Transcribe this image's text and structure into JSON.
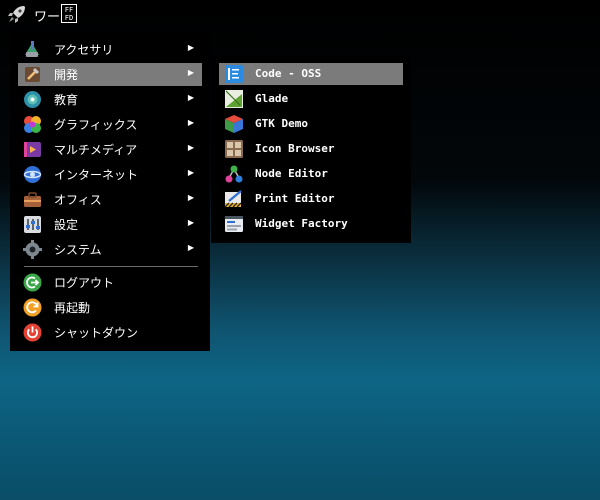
{
  "panel": {
    "workspace_label": "ワー",
    "unknown_glyph": "FFFD"
  },
  "menu": {
    "items": [
      {
        "label": "アクセサリ",
        "icon": "accessories-icon",
        "submenu": true
      },
      {
        "label": "開発",
        "icon": "development-icon",
        "submenu": true
      },
      {
        "label": "教育",
        "icon": "education-icon",
        "submenu": true
      },
      {
        "label": "グラフィックス",
        "icon": "graphics-icon",
        "submenu": true
      },
      {
        "label": "マルチメディア",
        "icon": "multimedia-icon",
        "submenu": true
      },
      {
        "label": "インターネット",
        "icon": "internet-icon",
        "submenu": true
      },
      {
        "label": "オフィス",
        "icon": "office-icon",
        "submenu": true
      },
      {
        "label": "設定",
        "icon": "settings-icon",
        "submenu": true
      },
      {
        "label": "システム",
        "icon": "system-icon",
        "submenu": true
      }
    ],
    "session": [
      {
        "label": "ログアウト",
        "icon": "logout-icon"
      },
      {
        "label": "再起動",
        "icon": "reboot-icon"
      },
      {
        "label": "シャットダウン",
        "icon": "shutdown-icon"
      }
    ],
    "arrow": "▶",
    "active": "開発"
  },
  "submenu": {
    "items": [
      {
        "label": "Code - OSS",
        "icon": "vscode-icon"
      },
      {
        "label": "Glade",
        "icon": "glade-icon"
      },
      {
        "label": "GTK Demo",
        "icon": "gtk-icon"
      },
      {
        "label": "Icon Browser",
        "icon": "icon-browser-icon"
      },
      {
        "label": "Node Editor",
        "icon": "node-editor-icon"
      },
      {
        "label": "Print Editor",
        "icon": "print-editor-icon"
      },
      {
        "label": "Widget Factory",
        "icon": "widget-factory-icon"
      }
    ],
    "active": "Code - OSS"
  },
  "colors": {
    "menu_bg": "#000000",
    "highlight": "#7b7b7b",
    "desktop_teal": "#0e6585"
  }
}
